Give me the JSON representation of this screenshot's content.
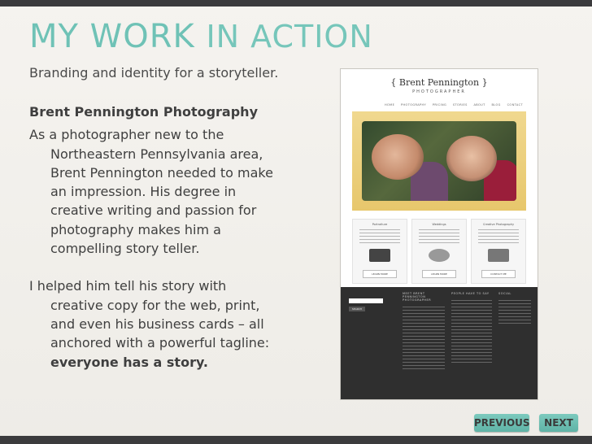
{
  "slide": {
    "title_part1": "MY WORK",
    "title_part2": "IN ACTION",
    "subtitle": "Branding and identity for a storyteller.",
    "heading": "Brent Pennington Photography",
    "paragraph1": "As a photographer new to the Northeastern Pennsylvania area, Brent Pennington needed to make an impression. His degree in creative writing and passion for photography makes him a compelling story teller.",
    "paragraph2_start": "I helped him tell his story with creative copy for the web, print, and even his business cards – all anchored with a powerful tagline: ",
    "paragraph2_bold": "everyone has a story."
  },
  "mockup": {
    "logo": "{ Brent Pennington }",
    "logo_sub": "PHOTOGRAPHER",
    "nav": [
      "HOME",
      "PHOTOGRAPHY",
      "PRICING",
      "STORIES",
      "ABOUT",
      "BLOG",
      "CONTACT"
    ],
    "cards": [
      {
        "title": "Portraiture",
        "button": "LEARN MORE"
      },
      {
        "title": "Weddings",
        "button": "LEARN MORE"
      },
      {
        "title": "Creative Photography",
        "button": "CONTACT ME"
      }
    ],
    "footer_cols": [
      "MEET BRENT PENNINGTON PHOTOGRAPHER",
      "PEOPLE HAVE TO SAY",
      "SOCIAL"
    ],
    "search_button": "SEARCH"
  },
  "nav_buttons": {
    "previous": "PREVIOUS",
    "next": "NEXT"
  }
}
